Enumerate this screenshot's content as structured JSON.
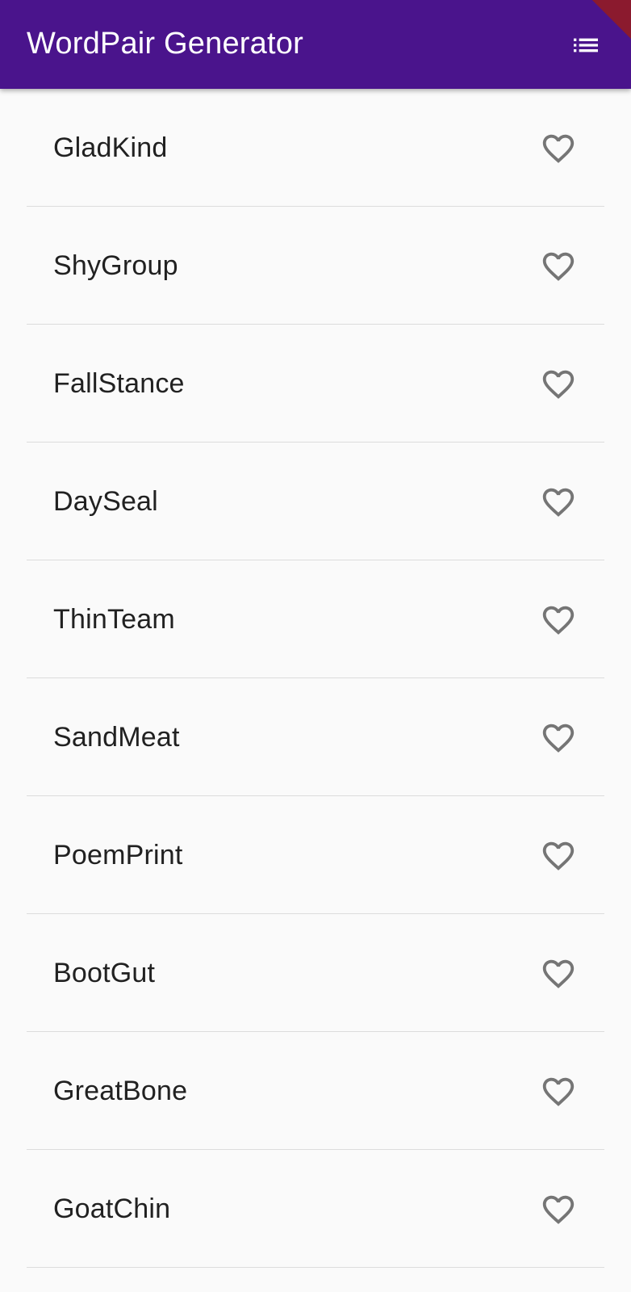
{
  "appbar": {
    "title": "WordPair Generator",
    "action_icon": "list-icon",
    "background": "#4a148c"
  },
  "list": {
    "items": [
      {
        "label": "GladKind"
      },
      {
        "label": "ShyGroup"
      },
      {
        "label": "FallStance"
      },
      {
        "label": "DaySeal"
      },
      {
        "label": "ThinTeam"
      },
      {
        "label": "SandMeat"
      },
      {
        "label": "PoemPrint"
      },
      {
        "label": "BootGut"
      },
      {
        "label": "GreatBone"
      },
      {
        "label": "GoatChin"
      }
    ],
    "item_icon": "heart-outline-icon"
  }
}
